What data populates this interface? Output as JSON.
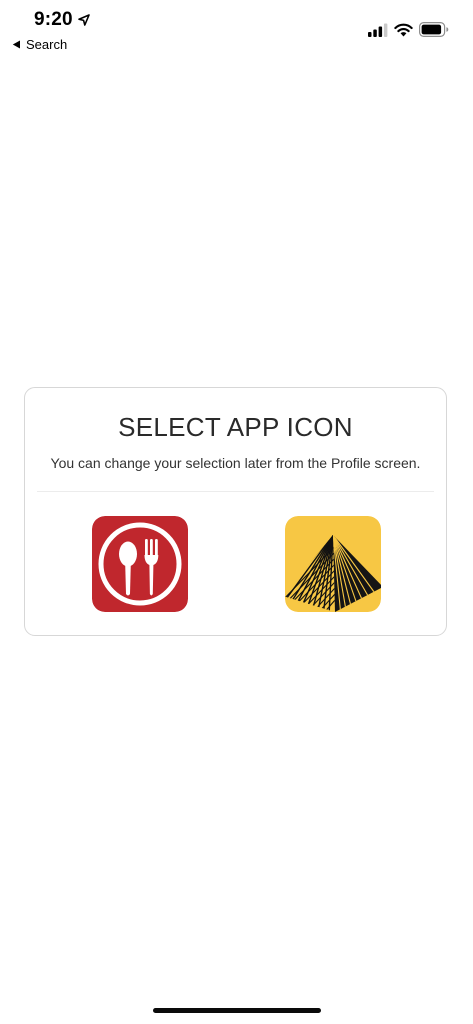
{
  "status_bar": {
    "time": "9:20",
    "back_label": "Search",
    "icons": [
      "location-arrow-icon",
      "back-triangle-icon",
      "cellular-signal-icon",
      "wifi-icon",
      "battery-icon"
    ]
  },
  "dialog": {
    "title": "SELECT APP ICON",
    "subtitle": "You can change your selection later from the Profile screen.",
    "options": [
      {
        "icon": "spoon-fork-icon",
        "background": "#c0272d"
      },
      {
        "icon": "pyramid-icon",
        "background": "#f7c744"
      }
    ]
  },
  "colors": {
    "accent_red": "#c0272d",
    "accent_yellow": "#f7c744",
    "card_border": "#d7d7d7"
  }
}
